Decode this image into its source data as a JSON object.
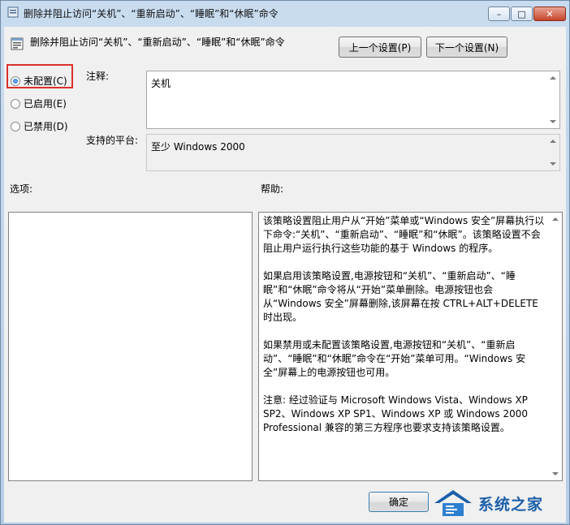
{
  "window": {
    "title": "删除并阻止访问“关机”、“重新启动”、“睡眠”和“休眠”命令",
    "controls": {
      "minimize": "–",
      "maximize": "□",
      "close": "✕"
    }
  },
  "header": {
    "policy_name": "删除并阻止访问“关机”、“重新启动”、“睡眠”和“休眠”命令",
    "prev_button": "上一个设置(P)",
    "next_button": "下一个设置(N)"
  },
  "state": {
    "options": [
      {
        "label": "未配置(C)",
        "checked": true
      },
      {
        "label": "已启用(E)",
        "checked": false
      },
      {
        "label": "已禁用(D)",
        "checked": false
      }
    ]
  },
  "comment": {
    "label": "注释:",
    "value": "关机"
  },
  "platform": {
    "label": "支持的平台:",
    "value": "至少 Windows 2000"
  },
  "sections": {
    "options_label": "选项:",
    "help_label": "帮助:"
  },
  "help": {
    "paragraphs": [
      "该策略设置阻止用户从“开始”菜单或“Windows 安全”屏幕执行以下命令:“关机”、“重新启动”、“睡眠”和“休眠”。该策略设置不会阻止用户运行执行这些功能的基于 Windows 的程序。",
      "如果启用该策略设置,电源按钮和“关机”、“重新启动”、“睡眠”和“休眠”命令将从“开始”菜单删除。电源按钮也会从“Windows 安全”屏幕删除,该屏幕在按 CTRL+ALT+DELETE 时出现。",
      "如果禁用或未配置该策略设置,电源按钮和“关机”、“重新启动”、“睡眠”和“休眠”命令在“开始”菜单可用。“Windows 安全”屏幕上的电源按钮也可用。",
      "注意: 经过验证与 Microsoft Windows Vista、Windows XP SP2、Windows XP SP1、Windows XP 或 Windows 2000 Professional 兼容的第三方程序也要求支持该策略设置。"
    ]
  },
  "footer": {
    "ok_button": "确定"
  },
  "watermark": {
    "text": "系统之家"
  }
}
